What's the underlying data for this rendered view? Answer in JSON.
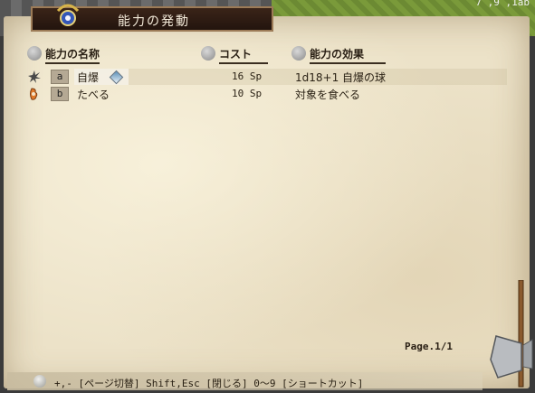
{
  "window": {
    "title": "能力の発動"
  },
  "status": {
    "coords": "7 ,9 ,1ab"
  },
  "columns": {
    "name": "能力の名称",
    "cost": "コスト",
    "effect": "能力の効果"
  },
  "abilities": [
    {
      "key": "a",
      "name": "自爆",
      "cost": "16 Sp",
      "effect": "1d18+1 自爆の球",
      "icon": "spark-icon",
      "selected": true
    },
    {
      "key": "b",
      "name": "たべる",
      "cost": "10 Sp",
      "effect": "対象を食べる",
      "icon": "mouth-icon",
      "selected": false
    }
  ],
  "page": "Page.1/1",
  "footer": {
    "hint": "+,- [ページ切替] Shift,Esc [閉じる] 0～9 [ショートカット]"
  },
  "colors": {
    "parchment": "#ece2c8",
    "titlebar": "#2b1a12",
    "text": "#2b2215"
  }
}
